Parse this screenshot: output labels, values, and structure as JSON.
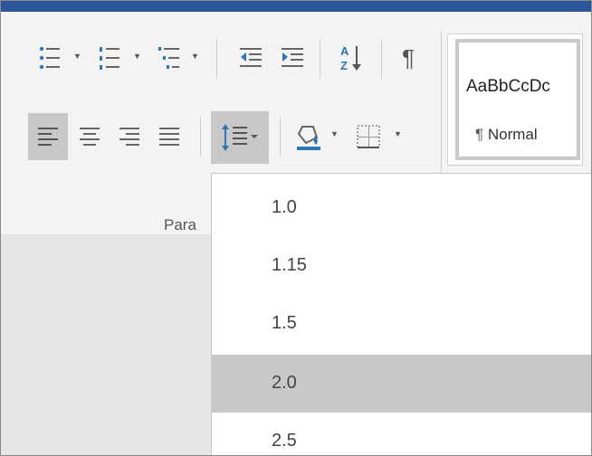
{
  "paragraph_group": {
    "label": "Para"
  },
  "styles": {
    "sample_text": "AaBbCcDc",
    "pilcrow": "¶",
    "name": "Normal"
  },
  "line_spacing_menu": {
    "items": [
      {
        "label": "1.0",
        "selected": false
      },
      {
        "label": "1.15",
        "selected": false
      },
      {
        "label": "1.5",
        "selected": false
      },
      {
        "label": "2.0",
        "selected": true
      },
      {
        "label": "2.5",
        "selected": false
      }
    ]
  },
  "icons": {
    "bullets": "bullets-icon",
    "numbering": "numbering-icon",
    "multilevel": "multilevel-list-icon",
    "decrease_indent": "decrease-indent-icon",
    "increase_indent": "increase-indent-icon",
    "sort": "sort-az-icon",
    "show_marks": "pilcrow-icon",
    "align_left": "align-left-icon",
    "center": "align-center-icon",
    "align_right": "align-right-icon",
    "justify": "justify-icon",
    "line_spacing": "line-spacing-icon",
    "shading": "shading-bucket-icon",
    "borders": "borders-icon"
  },
  "colors": {
    "accent": "#2b579a",
    "icon_blue": "#2e75b6",
    "selected_item": "#c8c8c8",
    "ribbon_bg": "#f3f3f3"
  }
}
